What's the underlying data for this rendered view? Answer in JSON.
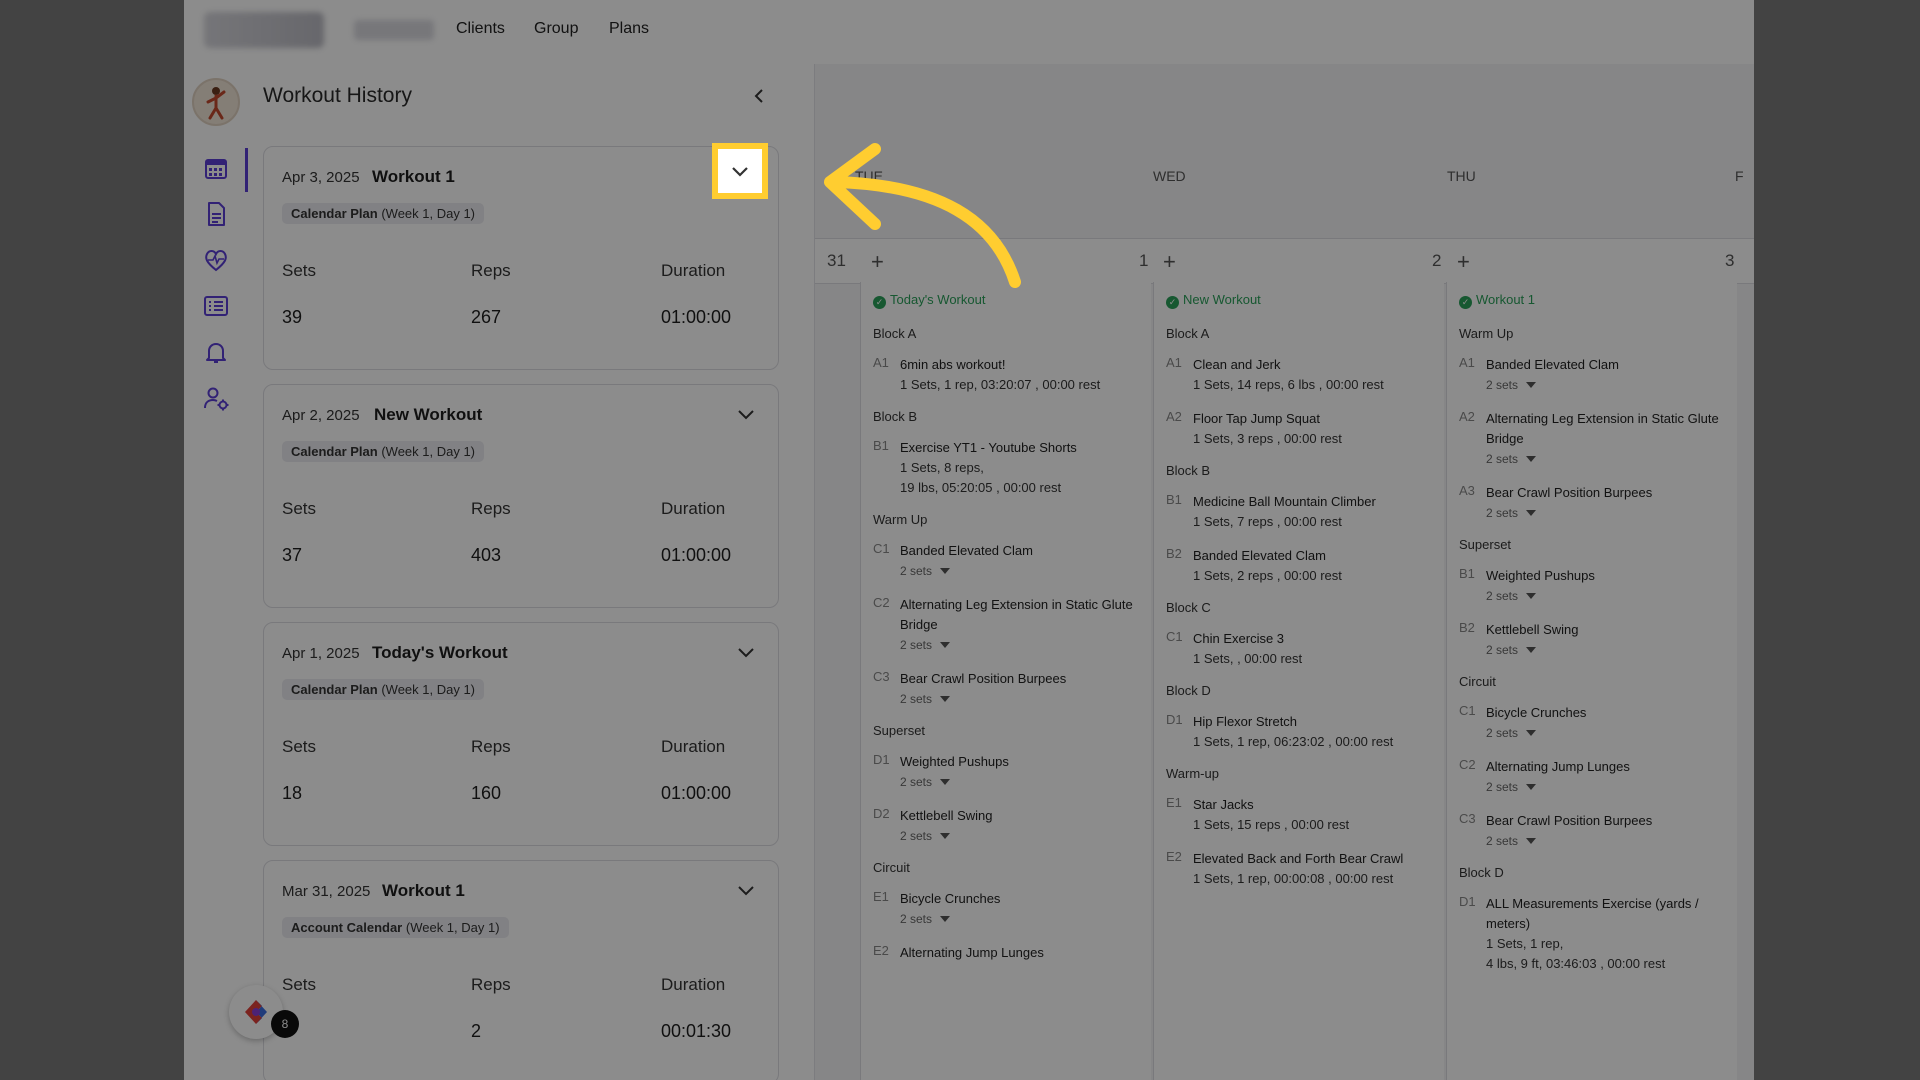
{
  "nav": {
    "links": [
      "Clients",
      "Group",
      "Plans"
    ]
  },
  "rail": {
    "icons": [
      "calendar-icon",
      "document-icon",
      "heart-pulse-icon",
      "list-icon",
      "bell-icon",
      "user-settings-icon"
    ]
  },
  "history": {
    "title": "Workout History",
    "labels": {
      "sets": "Sets",
      "reps": "Reps",
      "duration": "Duration"
    },
    "cards": [
      {
        "date": "Apr 3, 2025",
        "name": "Workout 1",
        "plan": "Calendar Plan",
        "week": "(Week 1, Day 1)",
        "sets": "39",
        "reps": "267",
        "duration": "01:00:00"
      },
      {
        "date": "Apr 2, 2025",
        "name": "New Workout",
        "plan": "Calendar Plan",
        "week": "(Week 1, Day 1)",
        "sets": "37",
        "reps": "403",
        "duration": "01:00:00"
      },
      {
        "date": "Apr 1, 2025",
        "name": "Today's Workout",
        "plan": "Calendar Plan",
        "week": "(Week 1, Day 1)",
        "sets": "18",
        "reps": "160",
        "duration": "01:00:00"
      },
      {
        "date": "Mar 31, 2025",
        "name": "Workout 1",
        "plan": "Account Calendar",
        "week": "(Week 1, Day 1)",
        "sets": "",
        "reps": "2",
        "duration": "00:01:30"
      }
    ],
    "helper_badge": "8"
  },
  "calendar": {
    "days": [
      {
        "head": "TUE",
        "num": "1"
      },
      {
        "head": "WED",
        "num": "2"
      },
      {
        "head": "THU",
        "num": "3"
      },
      {
        "head": "F",
        "num": ""
      }
    ],
    "prev_num": "31",
    "columns": [
      {
        "title": "Today's Workout",
        "blocks": [
          {
            "name": "Block A",
            "items": [
              {
                "code": "A1",
                "name": "6min abs workout!",
                "details": [
                  "1 Sets, 1 rep, 03:20:07 , 00:00 rest"
                ]
              }
            ]
          },
          {
            "name": "Block B",
            "items": [
              {
                "code": "B1",
                "name": "Exercise YT1 - Youtube Shorts",
                "details": [
                  "1 Sets, 8 reps,",
                  "19 lbs, 05:20:05 , 00:00 rest"
                ]
              }
            ]
          },
          {
            "name": "Warm Up",
            "items": [
              {
                "code": "C1",
                "name": "Banded Elevated Clam",
                "sets": "2 sets"
              },
              {
                "code": "C2",
                "name": "Alternating Leg Extension in Static Glute Bridge",
                "sets": "2 sets"
              },
              {
                "code": "C3",
                "name": "Bear Crawl Position Burpees",
                "sets": "2 sets"
              }
            ]
          },
          {
            "name": "Superset",
            "items": [
              {
                "code": "D1",
                "name": "Weighted Pushups",
                "sets": "2 sets"
              },
              {
                "code": "D2",
                "name": "Kettlebell Swing",
                "sets": "2 sets"
              }
            ]
          },
          {
            "name": "Circuit",
            "items": [
              {
                "code": "E1",
                "name": "Bicycle Crunches",
                "sets": "2 sets"
              },
              {
                "code": "E2",
                "name": "Alternating Jump Lunges"
              }
            ]
          }
        ]
      },
      {
        "title": "New Workout",
        "blocks": [
          {
            "name": "Block A",
            "items": [
              {
                "code": "A1",
                "name": "Clean and Jerk",
                "details": [
                  "1 Sets, 14 reps, 6 lbs , 00:00 rest"
                ]
              },
              {
                "code": "A2",
                "name": "Floor Tap Jump Squat",
                "details": [
                  "1 Sets, 3 reps , 00:00 rest"
                ]
              }
            ]
          },
          {
            "name": "Block B",
            "items": [
              {
                "code": "B1",
                "name": "Medicine Ball Mountain Climber",
                "details": [
                  "1 Sets, 7 reps , 00:00 rest"
                ]
              },
              {
                "code": "B2",
                "name": "Banded Elevated Clam",
                "details": [
                  "1 Sets, 2 reps , 00:00 rest"
                ]
              }
            ]
          },
          {
            "name": "Block C",
            "items": [
              {
                "code": "C1",
                "name": "Chin Exercise 3",
                "details": [
                  "1 Sets, , 00:00 rest"
                ]
              }
            ]
          },
          {
            "name": "Block D",
            "items": [
              {
                "code": "D1",
                "name": "Hip Flexor Stretch",
                "details": [
                  "1 Sets, 1 rep, 06:23:02 , 00:00 rest"
                ]
              }
            ]
          },
          {
            "name": "Warm-up",
            "items": [
              {
                "code": "E1",
                "name": "Star Jacks",
                "details": [
                  "1 Sets, 15 reps , 00:00 rest"
                ]
              },
              {
                "code": "E2",
                "name": "Elevated Back and Forth Bear Crawl",
                "details": [
                  "1 Sets, 1 rep, 00:00:08 , 00:00 rest"
                ]
              }
            ]
          }
        ]
      },
      {
        "title": "Workout 1",
        "blocks": [
          {
            "name": "Warm Up",
            "items": [
              {
                "code": "A1",
                "name": "Banded Elevated Clam",
                "sets": "2 sets"
              },
              {
                "code": "A2",
                "name": "Alternating Leg Extension in Static Glute Bridge",
                "sets": "2 sets"
              },
              {
                "code": "A3",
                "name": "Bear Crawl Position Burpees",
                "sets": "2 sets"
              }
            ]
          },
          {
            "name": "Superset",
            "items": [
              {
                "code": "B1",
                "name": "Weighted Pushups",
                "sets": "2 sets"
              },
              {
                "code": "B2",
                "name": "Kettlebell Swing",
                "sets": "2 sets"
              }
            ]
          },
          {
            "name": "Circuit",
            "items": [
              {
                "code": "C1",
                "name": "Bicycle Crunches",
                "sets": "2 sets"
              },
              {
                "code": "C2",
                "name": "Alternating Jump Lunges",
                "sets": "2 sets"
              },
              {
                "code": "C3",
                "name": "Bear Crawl Position Burpees",
                "sets": "2 sets"
              }
            ]
          },
          {
            "name": "Block D",
            "items": [
              {
                "code": "D1",
                "name": "ALL Measurements Exercise (yards / meters)",
                "details": [
                  "1 Sets, 1 rep,",
                  "4 lbs, 9 ft, 03:46:03 , 00:00 rest"
                ]
              }
            ]
          }
        ]
      }
    ]
  },
  "colors": {
    "accent": "#5b3fd6",
    "done": "#2aa05a",
    "highlight": "#ffcd30",
    "overlay": "rgba(0,0,0,0.45)"
  }
}
